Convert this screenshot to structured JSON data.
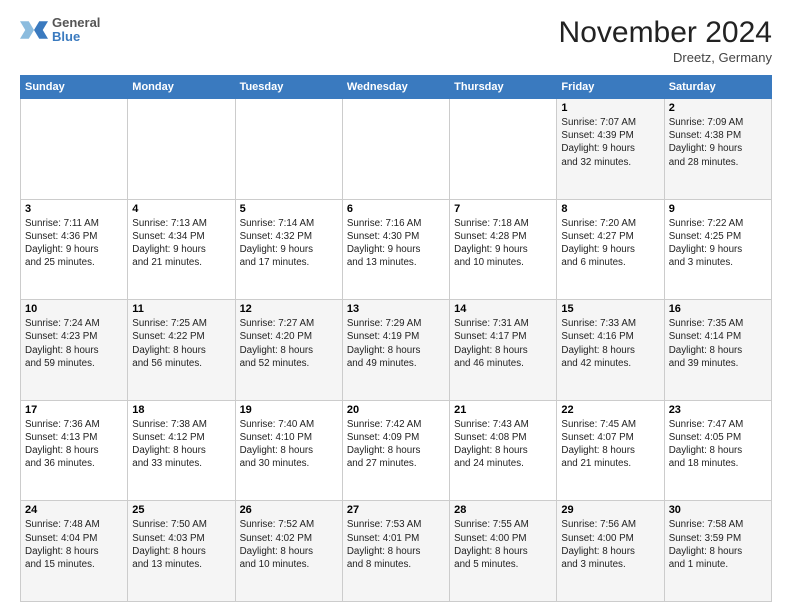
{
  "logo": {
    "line1": "General",
    "line2": "Blue"
  },
  "title": "November 2024",
  "location": "Dreetz, Germany",
  "days_of_week": [
    "Sunday",
    "Monday",
    "Tuesday",
    "Wednesday",
    "Thursday",
    "Friday",
    "Saturday"
  ],
  "weeks": [
    [
      {
        "day": "",
        "info": ""
      },
      {
        "day": "",
        "info": ""
      },
      {
        "day": "",
        "info": ""
      },
      {
        "day": "",
        "info": ""
      },
      {
        "day": "",
        "info": ""
      },
      {
        "day": "1",
        "info": "Sunrise: 7:07 AM\nSunset: 4:39 PM\nDaylight: 9 hours\nand 32 minutes."
      },
      {
        "day": "2",
        "info": "Sunrise: 7:09 AM\nSunset: 4:38 PM\nDaylight: 9 hours\nand 28 minutes."
      }
    ],
    [
      {
        "day": "3",
        "info": "Sunrise: 7:11 AM\nSunset: 4:36 PM\nDaylight: 9 hours\nand 25 minutes."
      },
      {
        "day": "4",
        "info": "Sunrise: 7:13 AM\nSunset: 4:34 PM\nDaylight: 9 hours\nand 21 minutes."
      },
      {
        "day": "5",
        "info": "Sunrise: 7:14 AM\nSunset: 4:32 PM\nDaylight: 9 hours\nand 17 minutes."
      },
      {
        "day": "6",
        "info": "Sunrise: 7:16 AM\nSunset: 4:30 PM\nDaylight: 9 hours\nand 13 minutes."
      },
      {
        "day": "7",
        "info": "Sunrise: 7:18 AM\nSunset: 4:28 PM\nDaylight: 9 hours\nand 10 minutes."
      },
      {
        "day": "8",
        "info": "Sunrise: 7:20 AM\nSunset: 4:27 PM\nDaylight: 9 hours\nand 6 minutes."
      },
      {
        "day": "9",
        "info": "Sunrise: 7:22 AM\nSunset: 4:25 PM\nDaylight: 9 hours\nand 3 minutes."
      }
    ],
    [
      {
        "day": "10",
        "info": "Sunrise: 7:24 AM\nSunset: 4:23 PM\nDaylight: 8 hours\nand 59 minutes."
      },
      {
        "day": "11",
        "info": "Sunrise: 7:25 AM\nSunset: 4:22 PM\nDaylight: 8 hours\nand 56 minutes."
      },
      {
        "day": "12",
        "info": "Sunrise: 7:27 AM\nSunset: 4:20 PM\nDaylight: 8 hours\nand 52 minutes."
      },
      {
        "day": "13",
        "info": "Sunrise: 7:29 AM\nSunset: 4:19 PM\nDaylight: 8 hours\nand 49 minutes."
      },
      {
        "day": "14",
        "info": "Sunrise: 7:31 AM\nSunset: 4:17 PM\nDaylight: 8 hours\nand 46 minutes."
      },
      {
        "day": "15",
        "info": "Sunrise: 7:33 AM\nSunset: 4:16 PM\nDaylight: 8 hours\nand 42 minutes."
      },
      {
        "day": "16",
        "info": "Sunrise: 7:35 AM\nSunset: 4:14 PM\nDaylight: 8 hours\nand 39 minutes."
      }
    ],
    [
      {
        "day": "17",
        "info": "Sunrise: 7:36 AM\nSunset: 4:13 PM\nDaylight: 8 hours\nand 36 minutes."
      },
      {
        "day": "18",
        "info": "Sunrise: 7:38 AM\nSunset: 4:12 PM\nDaylight: 8 hours\nand 33 minutes."
      },
      {
        "day": "19",
        "info": "Sunrise: 7:40 AM\nSunset: 4:10 PM\nDaylight: 8 hours\nand 30 minutes."
      },
      {
        "day": "20",
        "info": "Sunrise: 7:42 AM\nSunset: 4:09 PM\nDaylight: 8 hours\nand 27 minutes."
      },
      {
        "day": "21",
        "info": "Sunrise: 7:43 AM\nSunset: 4:08 PM\nDaylight: 8 hours\nand 24 minutes."
      },
      {
        "day": "22",
        "info": "Sunrise: 7:45 AM\nSunset: 4:07 PM\nDaylight: 8 hours\nand 21 minutes."
      },
      {
        "day": "23",
        "info": "Sunrise: 7:47 AM\nSunset: 4:05 PM\nDaylight: 8 hours\nand 18 minutes."
      }
    ],
    [
      {
        "day": "24",
        "info": "Sunrise: 7:48 AM\nSunset: 4:04 PM\nDaylight: 8 hours\nand 15 minutes."
      },
      {
        "day": "25",
        "info": "Sunrise: 7:50 AM\nSunset: 4:03 PM\nDaylight: 8 hours\nand 13 minutes."
      },
      {
        "day": "26",
        "info": "Sunrise: 7:52 AM\nSunset: 4:02 PM\nDaylight: 8 hours\nand 10 minutes."
      },
      {
        "day": "27",
        "info": "Sunrise: 7:53 AM\nSunset: 4:01 PM\nDaylight: 8 hours\nand 8 minutes."
      },
      {
        "day": "28",
        "info": "Sunrise: 7:55 AM\nSunset: 4:00 PM\nDaylight: 8 hours\nand 5 minutes."
      },
      {
        "day": "29",
        "info": "Sunrise: 7:56 AM\nSunset: 4:00 PM\nDaylight: 8 hours\nand 3 minutes."
      },
      {
        "day": "30",
        "info": "Sunrise: 7:58 AM\nSunset: 3:59 PM\nDaylight: 8 hours\nand 1 minute."
      }
    ]
  ]
}
